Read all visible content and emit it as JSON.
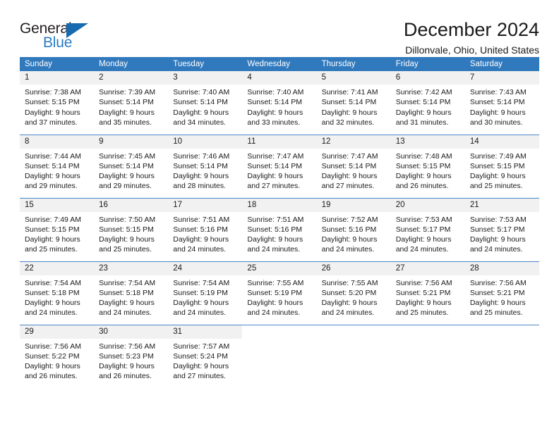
{
  "logo": {
    "primary_text": "General",
    "secondary_text": "Blue",
    "triangle_icon": "blue-triangle-icon",
    "primary_color": "#231f20",
    "secondary_color": "#2a7cc7",
    "triangle_color": "#1769b0"
  },
  "header": {
    "title": "December 2024",
    "subtitle": "Dillonvale, Ohio, United States"
  },
  "theme": {
    "header_row_bg": "#3179bd",
    "header_row_text": "#ffffff",
    "daynum_bg": "#f1f1f1",
    "row_divider": "#4a86c5",
    "page_bg": "#ffffff",
    "body_text": "#1a1a1a"
  },
  "calendar": {
    "weekday_headers": [
      "Sunday",
      "Monday",
      "Tuesday",
      "Wednesday",
      "Thursday",
      "Friday",
      "Saturday"
    ],
    "weeks": [
      [
        {
          "day": "1",
          "sunrise": "Sunrise: 7:38 AM",
          "sunset": "Sunset: 5:15 PM",
          "daylight_line1": "Daylight: 9 hours",
          "daylight_line2": "and 37 minutes."
        },
        {
          "day": "2",
          "sunrise": "Sunrise: 7:39 AM",
          "sunset": "Sunset: 5:14 PM",
          "daylight_line1": "Daylight: 9 hours",
          "daylight_line2": "and 35 minutes."
        },
        {
          "day": "3",
          "sunrise": "Sunrise: 7:40 AM",
          "sunset": "Sunset: 5:14 PM",
          "daylight_line1": "Daylight: 9 hours",
          "daylight_line2": "and 34 minutes."
        },
        {
          "day": "4",
          "sunrise": "Sunrise: 7:40 AM",
          "sunset": "Sunset: 5:14 PM",
          "daylight_line1": "Daylight: 9 hours",
          "daylight_line2": "and 33 minutes."
        },
        {
          "day": "5",
          "sunrise": "Sunrise: 7:41 AM",
          "sunset": "Sunset: 5:14 PM",
          "daylight_line1": "Daylight: 9 hours",
          "daylight_line2": "and 32 minutes."
        },
        {
          "day": "6",
          "sunrise": "Sunrise: 7:42 AM",
          "sunset": "Sunset: 5:14 PM",
          "daylight_line1": "Daylight: 9 hours",
          "daylight_line2": "and 31 minutes."
        },
        {
          "day": "7",
          "sunrise": "Sunrise: 7:43 AM",
          "sunset": "Sunset: 5:14 PM",
          "daylight_line1": "Daylight: 9 hours",
          "daylight_line2": "and 30 minutes."
        }
      ],
      [
        {
          "day": "8",
          "sunrise": "Sunrise: 7:44 AM",
          "sunset": "Sunset: 5:14 PM",
          "daylight_line1": "Daylight: 9 hours",
          "daylight_line2": "and 29 minutes."
        },
        {
          "day": "9",
          "sunrise": "Sunrise: 7:45 AM",
          "sunset": "Sunset: 5:14 PM",
          "daylight_line1": "Daylight: 9 hours",
          "daylight_line2": "and 29 minutes."
        },
        {
          "day": "10",
          "sunrise": "Sunrise: 7:46 AM",
          "sunset": "Sunset: 5:14 PM",
          "daylight_line1": "Daylight: 9 hours",
          "daylight_line2": "and 28 minutes."
        },
        {
          "day": "11",
          "sunrise": "Sunrise: 7:47 AM",
          "sunset": "Sunset: 5:14 PM",
          "daylight_line1": "Daylight: 9 hours",
          "daylight_line2": "and 27 minutes."
        },
        {
          "day": "12",
          "sunrise": "Sunrise: 7:47 AM",
          "sunset": "Sunset: 5:14 PM",
          "daylight_line1": "Daylight: 9 hours",
          "daylight_line2": "and 27 minutes."
        },
        {
          "day": "13",
          "sunrise": "Sunrise: 7:48 AM",
          "sunset": "Sunset: 5:15 PM",
          "daylight_line1": "Daylight: 9 hours",
          "daylight_line2": "and 26 minutes."
        },
        {
          "day": "14",
          "sunrise": "Sunrise: 7:49 AM",
          "sunset": "Sunset: 5:15 PM",
          "daylight_line1": "Daylight: 9 hours",
          "daylight_line2": "and 25 minutes."
        }
      ],
      [
        {
          "day": "15",
          "sunrise": "Sunrise: 7:49 AM",
          "sunset": "Sunset: 5:15 PM",
          "daylight_line1": "Daylight: 9 hours",
          "daylight_line2": "and 25 minutes."
        },
        {
          "day": "16",
          "sunrise": "Sunrise: 7:50 AM",
          "sunset": "Sunset: 5:15 PM",
          "daylight_line1": "Daylight: 9 hours",
          "daylight_line2": "and 25 minutes."
        },
        {
          "day": "17",
          "sunrise": "Sunrise: 7:51 AM",
          "sunset": "Sunset: 5:16 PM",
          "daylight_line1": "Daylight: 9 hours",
          "daylight_line2": "and 24 minutes."
        },
        {
          "day": "18",
          "sunrise": "Sunrise: 7:51 AM",
          "sunset": "Sunset: 5:16 PM",
          "daylight_line1": "Daylight: 9 hours",
          "daylight_line2": "and 24 minutes."
        },
        {
          "day": "19",
          "sunrise": "Sunrise: 7:52 AM",
          "sunset": "Sunset: 5:16 PM",
          "daylight_line1": "Daylight: 9 hours",
          "daylight_line2": "and 24 minutes."
        },
        {
          "day": "20",
          "sunrise": "Sunrise: 7:53 AM",
          "sunset": "Sunset: 5:17 PM",
          "daylight_line1": "Daylight: 9 hours",
          "daylight_line2": "and 24 minutes."
        },
        {
          "day": "21",
          "sunrise": "Sunrise: 7:53 AM",
          "sunset": "Sunset: 5:17 PM",
          "daylight_line1": "Daylight: 9 hours",
          "daylight_line2": "and 24 minutes."
        }
      ],
      [
        {
          "day": "22",
          "sunrise": "Sunrise: 7:54 AM",
          "sunset": "Sunset: 5:18 PM",
          "daylight_line1": "Daylight: 9 hours",
          "daylight_line2": "and 24 minutes."
        },
        {
          "day": "23",
          "sunrise": "Sunrise: 7:54 AM",
          "sunset": "Sunset: 5:18 PM",
          "daylight_line1": "Daylight: 9 hours",
          "daylight_line2": "and 24 minutes."
        },
        {
          "day": "24",
          "sunrise": "Sunrise: 7:54 AM",
          "sunset": "Sunset: 5:19 PM",
          "daylight_line1": "Daylight: 9 hours",
          "daylight_line2": "and 24 minutes."
        },
        {
          "day": "25",
          "sunrise": "Sunrise: 7:55 AM",
          "sunset": "Sunset: 5:19 PM",
          "daylight_line1": "Daylight: 9 hours",
          "daylight_line2": "and 24 minutes."
        },
        {
          "day": "26",
          "sunrise": "Sunrise: 7:55 AM",
          "sunset": "Sunset: 5:20 PM",
          "daylight_line1": "Daylight: 9 hours",
          "daylight_line2": "and 24 minutes."
        },
        {
          "day": "27",
          "sunrise": "Sunrise: 7:56 AM",
          "sunset": "Sunset: 5:21 PM",
          "daylight_line1": "Daylight: 9 hours",
          "daylight_line2": "and 25 minutes."
        },
        {
          "day": "28",
          "sunrise": "Sunrise: 7:56 AM",
          "sunset": "Sunset: 5:21 PM",
          "daylight_line1": "Daylight: 9 hours",
          "daylight_line2": "and 25 minutes."
        }
      ],
      [
        {
          "day": "29",
          "sunrise": "Sunrise: 7:56 AM",
          "sunset": "Sunset: 5:22 PM",
          "daylight_line1": "Daylight: 9 hours",
          "daylight_line2": "and 26 minutes."
        },
        {
          "day": "30",
          "sunrise": "Sunrise: 7:56 AM",
          "sunset": "Sunset: 5:23 PM",
          "daylight_line1": "Daylight: 9 hours",
          "daylight_line2": "and 26 minutes."
        },
        {
          "day": "31",
          "sunrise": "Sunrise: 7:57 AM",
          "sunset": "Sunset: 5:24 PM",
          "daylight_line1": "Daylight: 9 hours",
          "daylight_line2": "and 27 minutes."
        },
        {
          "day": "",
          "sunrise": "",
          "sunset": "",
          "daylight_line1": "",
          "daylight_line2": ""
        },
        {
          "day": "",
          "sunrise": "",
          "sunset": "",
          "daylight_line1": "",
          "daylight_line2": ""
        },
        {
          "day": "",
          "sunrise": "",
          "sunset": "",
          "daylight_line1": "",
          "daylight_line2": ""
        },
        {
          "day": "",
          "sunrise": "",
          "sunset": "",
          "daylight_line1": "",
          "daylight_line2": ""
        }
      ]
    ]
  }
}
